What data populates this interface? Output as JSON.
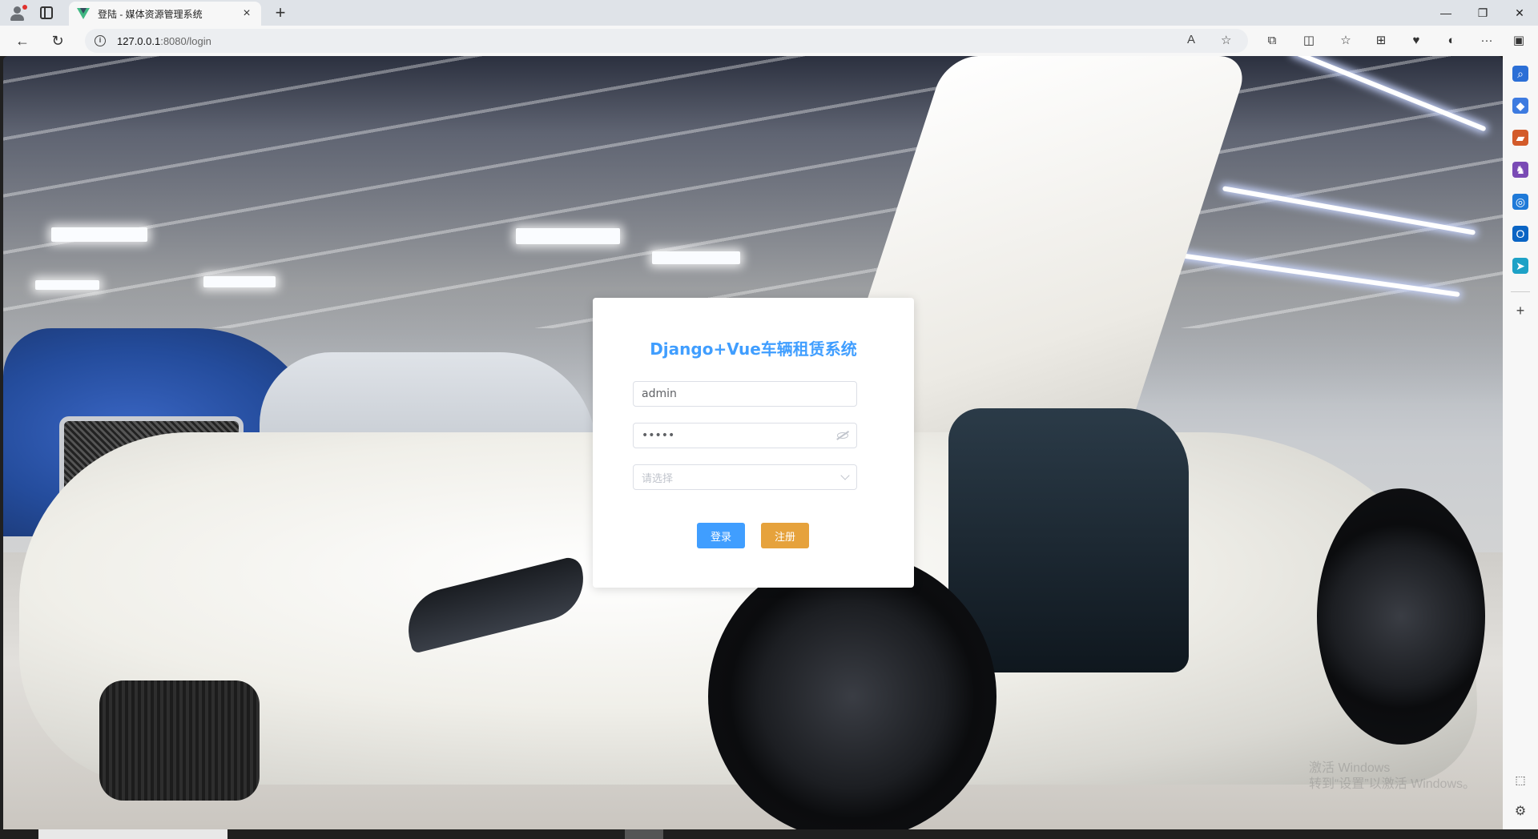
{
  "browser": {
    "tab_title": "登陆 - 媒体资源管理系统",
    "tab_close": "×",
    "new_tab": "+",
    "window_controls": {
      "minimize": "—",
      "restore": "❐",
      "close": "✕"
    },
    "nav": {
      "back": "←",
      "refresh": "↻"
    },
    "address": {
      "host": "127.0.0.1",
      "rest": ":8080/login"
    },
    "address_tools": {
      "read_aloud": "A",
      "favorite": "☆"
    },
    "toolbar_icons": [
      "extensions-icon",
      "split-screen-icon",
      "favorites-icon",
      "collections-icon",
      "performance-icon",
      "copilot-icon",
      "more-icon",
      "sidebar-toggle-icon"
    ],
    "toolbar_glyphs": {
      "extensions": "⧉",
      "split": "◫",
      "favorites": "☆",
      "collections": "⊞",
      "performance": "♥",
      "copilot": "◐",
      "more": "···",
      "sidebar": "▣"
    }
  },
  "sidebar": {
    "icons": [
      {
        "name": "search-icon",
        "glyph": "⌕",
        "color": "#2b6fd6"
      },
      {
        "name": "shopping-icon",
        "glyph": "◆",
        "color": "#3d7be0"
      },
      {
        "name": "tools-icon",
        "glyph": "▰",
        "color": "#d35b2a"
      },
      {
        "name": "games-icon",
        "glyph": "♞",
        "color": "#7a4bb5"
      },
      {
        "name": "office-icon",
        "glyph": "◎",
        "color": "#1f7ad8"
      },
      {
        "name": "outlook-icon",
        "glyph": "O",
        "color": "#0a64c4"
      },
      {
        "name": "send-icon",
        "glyph": "➤",
        "color": "#1da1c6"
      }
    ],
    "add": "+",
    "bottom": {
      "screenshot": "⬚",
      "settings": "⚙"
    }
  },
  "login": {
    "title": "Django+Vue车辆租赁系统",
    "username_value": "admin",
    "password_value": "•••••",
    "role_placeholder": "请选择",
    "login_button": "登录",
    "register_button": "注册"
  },
  "colors": {
    "primary": "#409eff",
    "warning": "#e6a23c",
    "placeholder": "#c0c4cc",
    "border": "#dcdfe6"
  },
  "watermark": {
    "line1": "激活 Windows",
    "line2": "转到“设置”以激活 Windows。"
  }
}
